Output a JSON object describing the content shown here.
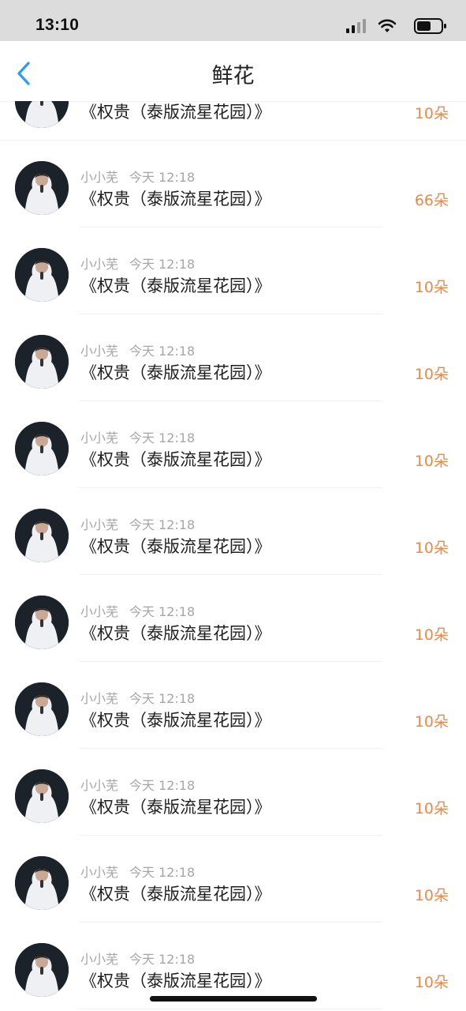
{
  "status_bar": {
    "time": "13:10"
  },
  "nav": {
    "title": "鲜花"
  },
  "items": [
    {
      "user": "",
      "time": "",
      "work": "《权贵（泰版流星花园）》",
      "amount": "10朵"
    },
    {
      "user": "小小芜",
      "time": "今天 12:18",
      "work": "《权贵（泰版流星花园）》",
      "amount": "66朵"
    },
    {
      "user": "小小芜",
      "time": "今天 12:18",
      "work": "《权贵（泰版流星花园）》",
      "amount": "10朵"
    },
    {
      "user": "小小芜",
      "time": "今天 12:18",
      "work": "《权贵（泰版流星花园）》",
      "amount": "10朵"
    },
    {
      "user": "小小芜",
      "time": "今天 12:18",
      "work": "《权贵（泰版流星花园）》",
      "amount": "10朵"
    },
    {
      "user": "小小芜",
      "time": "今天 12:18",
      "work": "《权贵（泰版流星花园）》",
      "amount": "10朵"
    },
    {
      "user": "小小芜",
      "time": "今天 12:18",
      "work": "《权贵（泰版流星花园）》",
      "amount": "10朵"
    },
    {
      "user": "小小芜",
      "time": "今天 12:18",
      "work": "《权贵（泰版流星花园）》",
      "amount": "10朵"
    },
    {
      "user": "小小芜",
      "time": "今天 12:18",
      "work": "《权贵（泰版流星花园）》",
      "amount": "10朵"
    },
    {
      "user": "小小芜",
      "time": "今天 12:18",
      "work": "《权贵（泰版流星花园）》",
      "amount": "10朵"
    },
    {
      "user": "小小芜",
      "time": "今天 12:18",
      "work": "《权贵（泰版流星花园）》",
      "amount": "10朵"
    }
  ],
  "icons": {
    "back": "chevron-left-icon",
    "signal": "cellular-signal-icon",
    "wifi": "wifi-icon",
    "battery": "battery-icon"
  },
  "colors": {
    "accent": "#2d9cf0",
    "amount": "#f08844",
    "meta": "#a6a6a6"
  }
}
